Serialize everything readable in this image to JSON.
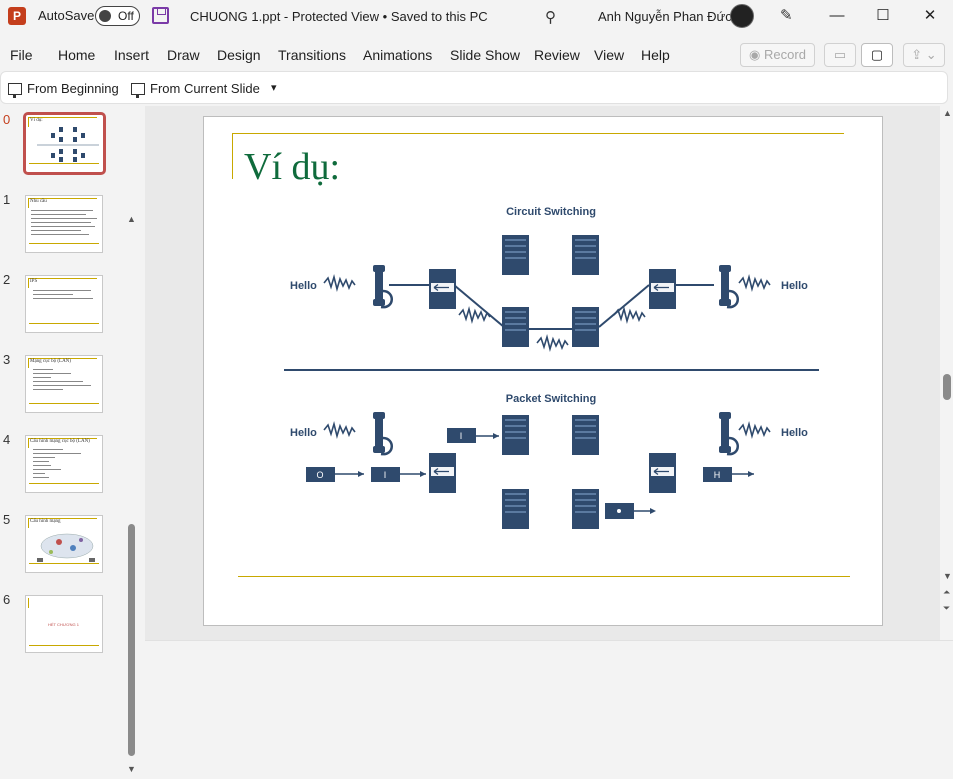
{
  "title_bar": {
    "app_logo_letter": "P",
    "autosave_label": "AutoSave",
    "autosave_state": "Off",
    "document_title": "CHUONG 1.ppt  -  Protected View • Saved to this PC",
    "user_name": "Anh Nguyễn Phan Đức"
  },
  "menu": {
    "items": [
      "File",
      "Home",
      "Insert",
      "Draw",
      "Design",
      "Transitions",
      "Animations",
      "Slide Show",
      "Review",
      "View",
      "Help"
    ],
    "record_label": "Record"
  },
  "ribbon": {
    "from_beginning": "From Beginning",
    "from_current": "From Current Slide",
    "more_icon": "▾"
  },
  "thumbnails": [
    {
      "number": "0",
      "title": "Ví dụ:",
      "selected": true
    },
    {
      "number": "1",
      "title": "Nhu cầu"
    },
    {
      "number": "2",
      "title": "IPS"
    },
    {
      "number": "3",
      "title": "Mạng cục bộ (LAN)"
    },
    {
      "number": "4",
      "title": "Cấu hình mạng cục bộ (LAN)"
    },
    {
      "number": "5",
      "title": "Cấu hình mạng"
    },
    {
      "number": "6",
      "title": "",
      "center_text": "HẾT CHƯƠNG 1"
    }
  ],
  "slide": {
    "title": "Ví dụ:",
    "diagram": {
      "top_heading": "Circuit Switching",
      "bottom_heading": "Packet Switching",
      "hello_left": "Hello",
      "hello_right": "Hello",
      "packet_labels": [
        "I",
        "O",
        "I",
        "H"
      ]
    }
  },
  "colors": {
    "accent": "#c43e1c",
    "title_green": "#0f6b3c",
    "gold_line": "#c8a800",
    "diagram_blue": "#2f4a6d"
  },
  "icons": [
    "search-icon",
    "pen-icon",
    "minimize-icon",
    "maximize-icon",
    "close-icon",
    "comment-icon",
    "share-icon",
    "save-icon"
  ]
}
